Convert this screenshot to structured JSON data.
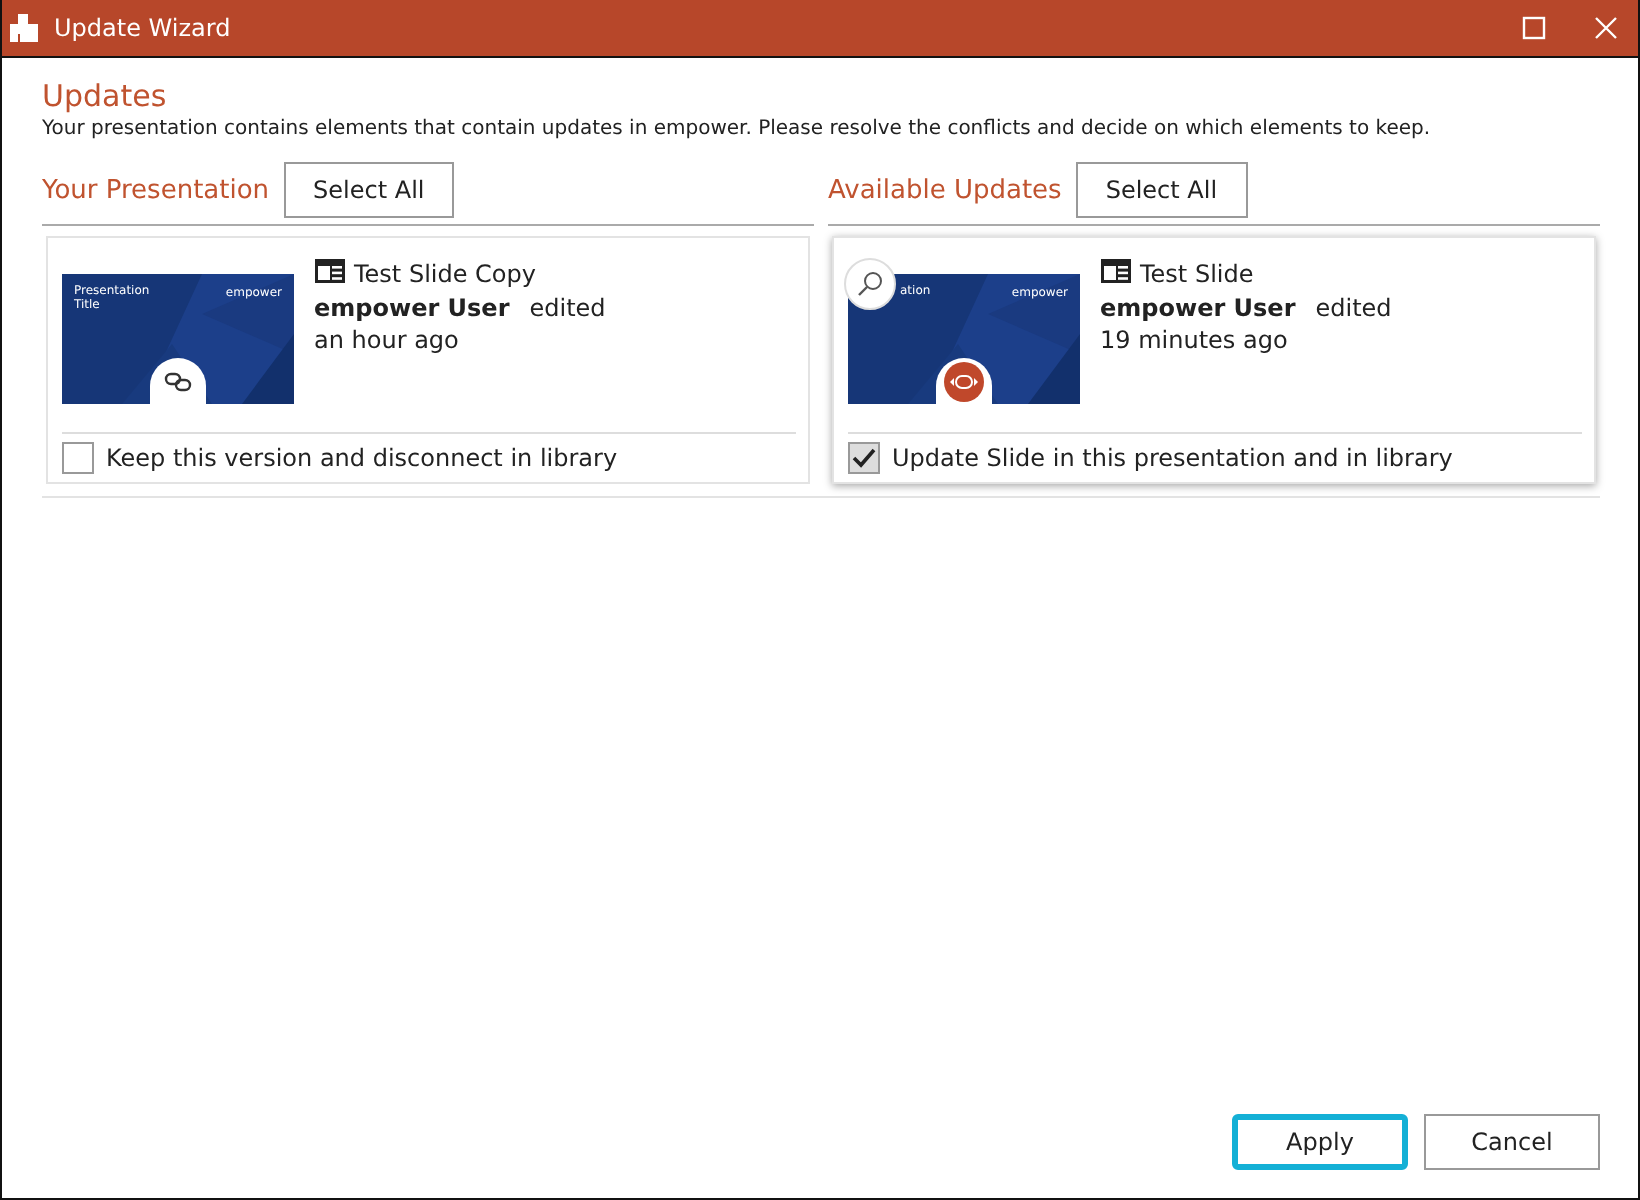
{
  "window": {
    "title": "Update Wizard"
  },
  "heading": "Updates",
  "description": "Your presentation contains elements that contain updates in empower. Please resolve the conflicts and decide on which elements to keep.",
  "columns": [
    {
      "title": "Your Presentation",
      "select_all": "Select All",
      "card": {
        "kind": "link",
        "magnifier": false,
        "thumb_title": "Presentation Title",
        "thumb_brand": "empower",
        "name": "Test Slide Copy",
        "user": "empower User",
        "action": "edited",
        "time": "an hour ago",
        "option": "Keep this version and disconnect in library",
        "checked": false
      }
    },
    {
      "title": "Available Updates",
      "select_all": "Select All",
      "card": {
        "kind": "update",
        "magnifier": true,
        "thumb_title": "ation",
        "thumb_brand": "empower",
        "name": "Test Slide",
        "user": "empower User",
        "action": "edited",
        "time": "19 minutes ago",
        "option": "Update Slide in this presentation and in library",
        "checked": true
      }
    }
  ],
  "buttons": [
    {
      "label": "Apply",
      "focused": true
    },
    {
      "label": "Cancel",
      "focused": false
    }
  ]
}
